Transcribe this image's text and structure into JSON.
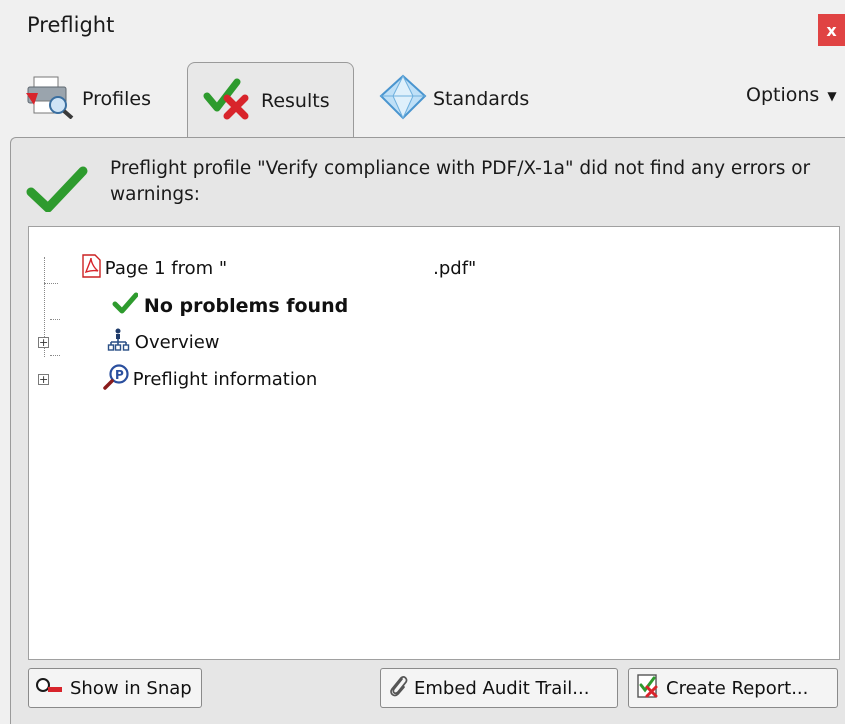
{
  "window": {
    "title": "Preflight",
    "close_label": "x"
  },
  "tabs": [
    {
      "label": "Profiles",
      "icon": "profiles-printer-icon",
      "active": false
    },
    {
      "label": "Results",
      "icon": "results-check-cross-icon",
      "active": true
    },
    {
      "label": "Standards",
      "icon": "standards-diamond-icon",
      "active": false
    }
  ],
  "options_label": "Options",
  "summary": {
    "icon": "success-checkmark-icon",
    "message": "Preflight profile \"Verify compliance with PDF/X-1a\" did not find any errors or warnings:"
  },
  "results_tree": {
    "root": {
      "label": "Page 1 from \"                                    .pdf\"",
      "icon": "pdf-file-icon"
    },
    "children": [
      {
        "label": "No problems found",
        "icon": "checkmark-icon",
        "expandable": false,
        "bold": true
      },
      {
        "label": "Overview",
        "icon": "hierarchy-icon",
        "expandable": true,
        "bold": false
      },
      {
        "label": "Preflight information",
        "icon": "magnifier-p-icon",
        "expandable": true,
        "bold": false
      }
    ]
  },
  "buttons": {
    "show_in_snap": "Show in Snap",
    "embed_audit_trail": "Embed Audit Trail...",
    "create_report": "Create Report..."
  },
  "colors": {
    "close_button": "#e04343",
    "check_green": "#2e9b2e",
    "cross_red": "#d8242b"
  }
}
